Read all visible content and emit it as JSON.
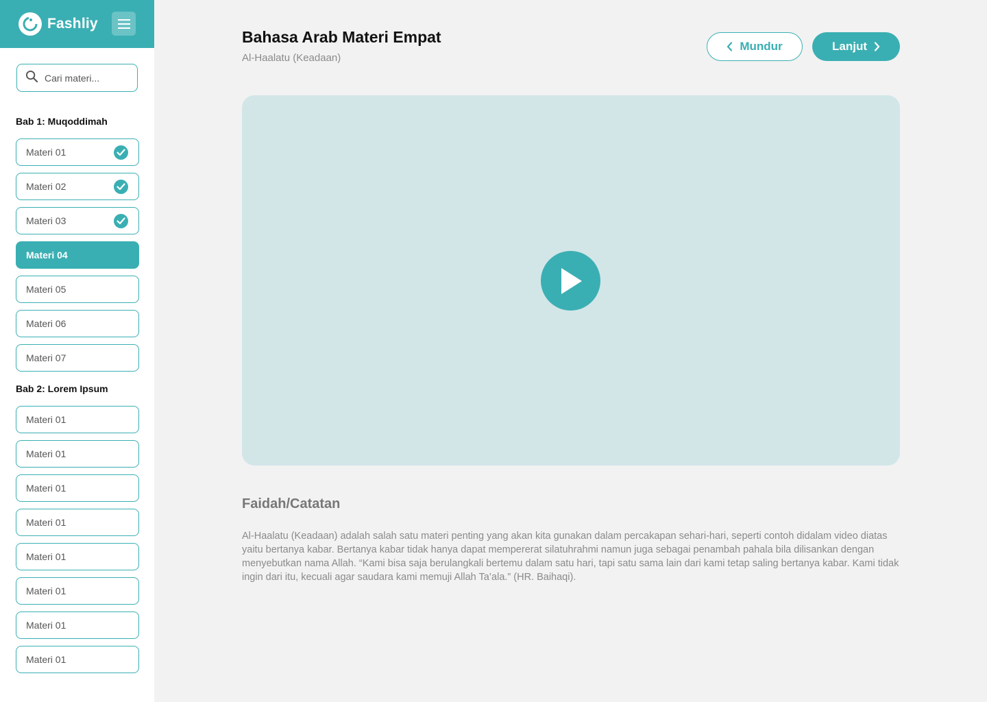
{
  "app": {
    "name": "Fashliy"
  },
  "sidebar": {
    "search_placeholder": "Cari materi...",
    "sections": [
      {
        "title": "Bab 1: Muqoddimah",
        "items": [
          {
            "label": "Materi 01",
            "completed": true,
            "active": false
          },
          {
            "label": "Materi 02",
            "completed": true,
            "active": false
          },
          {
            "label": "Materi 03",
            "completed": true,
            "active": false
          },
          {
            "label": "Materi 04",
            "completed": false,
            "active": true
          },
          {
            "label": "Materi 05",
            "completed": false,
            "active": false
          },
          {
            "label": "Materi 06",
            "completed": false,
            "active": false
          },
          {
            "label": "Materi 07",
            "completed": false,
            "active": false
          }
        ]
      },
      {
        "title": "Bab 2: Lorem Ipsum",
        "items": [
          {
            "label": "Materi 01",
            "completed": false,
            "active": false
          },
          {
            "label": "Materi 01",
            "completed": false,
            "active": false
          },
          {
            "label": "Materi 01",
            "completed": false,
            "active": false
          },
          {
            "label": "Materi 01",
            "completed": false,
            "active": false
          },
          {
            "label": "Materi 01",
            "completed": false,
            "active": false
          },
          {
            "label": "Materi 01",
            "completed": false,
            "active": false
          },
          {
            "label": "Materi 01",
            "completed": false,
            "active": false
          },
          {
            "label": "Materi 01",
            "completed": false,
            "active": false
          }
        ]
      }
    ]
  },
  "main": {
    "title": "Bahasa Arab Materi Empat",
    "subtitle": "Al-Haalatu (Keadaan)",
    "back_label": "Mundur",
    "next_label": "Lanjut",
    "notes_title": "Faidah/Catatan",
    "notes_body": "Al-Haalatu (Keadaan) adalah salah satu materi penting yang akan kita gunakan dalam percakapan sehari-hari, seperti contoh didalam video diatas yaitu bertanya kabar. Bertanya kabar tidak hanya dapat mempererat silatuhrahmi namun juga sebagai penambah pahala bila dilisankan dengan menyebutkan nama Allah. “Kami bisa saja berulangkali bertemu dalam satu hari, tapi satu sama lain dari kami tetap saling bertanya kabar. Kami tidak ingin dari itu, kecuali agar saudara kami memuji Allah Ta’ala.” (HR. Baihaqi)."
  },
  "colors": {
    "accent": "#3aafb3",
    "video_bg": "#d2e6e8",
    "page_bg": "#f2f2f2"
  },
  "icons": {
    "logo": "fashliy-logo-icon",
    "menu": "hamburger-menu-icon",
    "search": "search-icon",
    "check": "check-circle-icon",
    "back": "chevron-left-icon",
    "next": "chevron-right-icon",
    "play": "play-icon"
  }
}
